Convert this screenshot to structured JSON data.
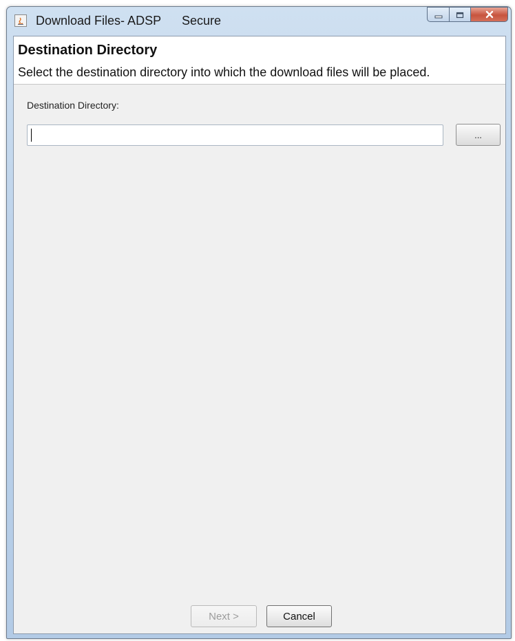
{
  "window": {
    "title": "Download Files- ADSP",
    "security_label": "Secure",
    "controls": {
      "minimize_icon": "minimize-icon",
      "maximize_icon": "maximize-icon",
      "close_icon": "close-icon"
    }
  },
  "header": {
    "title": "Destination Directory",
    "description": "Select the destination directory into which the download files will be placed."
  },
  "form": {
    "destination_label": "Destination Directory:",
    "destination_value": "",
    "browse_label": "..."
  },
  "footer": {
    "next_label": "Next >",
    "next_enabled": false,
    "cancel_label": "Cancel"
  },
  "colors": {
    "titlebar": "#bcd2ea",
    "client_background": "#f0f0f0",
    "close_button": "#c7543e"
  }
}
